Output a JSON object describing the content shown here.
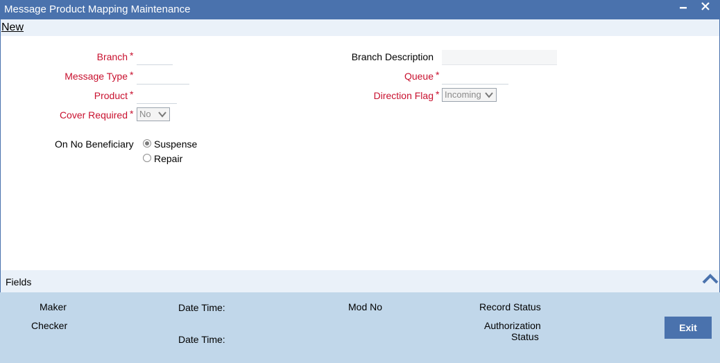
{
  "window": {
    "title": "Message Product Mapping Maintenance",
    "minimize": "▬",
    "close": "✕"
  },
  "menu": {
    "new_label": "New"
  },
  "form": {
    "branch_label": "Branch",
    "message_type_label": "Message Type",
    "product_label": "Product",
    "cover_required_label": "Cover Required",
    "cover_required_value": "No",
    "branch_description_label": "Branch Description",
    "queue_label": "Queue",
    "direction_flag_label": "Direction Flag",
    "direction_flag_value": "Incoming",
    "required_marker": "*",
    "on_no_beneficiary_label": "On No Beneficiary",
    "options": [
      {
        "label": "Suspense",
        "checked": true
      },
      {
        "label": "Repair",
        "checked": false
      }
    ]
  },
  "fields_bar": {
    "label": "Fields"
  },
  "audit": {
    "maker": "Maker",
    "checker": "Checker",
    "date_time_1": "Date Time:",
    "date_time_2": "Date Time:",
    "mod_no": "Mod No",
    "record_status": "Record Status",
    "authorization_status_1": "Authorization",
    "authorization_status_2": "Status"
  },
  "buttons": {
    "exit": "Exit"
  },
  "colors": {
    "title_bar": "#4a72ad",
    "required_label": "#c8102e",
    "audit_panel": "#c1d7ea",
    "menu_bar": "#eaf1f9"
  }
}
